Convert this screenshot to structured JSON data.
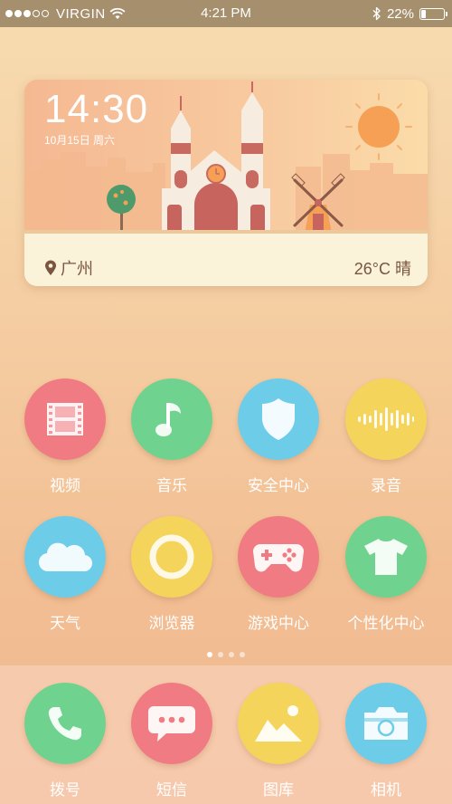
{
  "status": {
    "carrier": "VIRGIN",
    "time": "4:21 PM",
    "battery": "22%",
    "battery_level": 0.22
  },
  "widget": {
    "time": "14:30",
    "date": "10月15日 周六",
    "city": "广州",
    "weather": "26°C 晴"
  },
  "apps": [
    {
      "label": "视频",
      "icon": "film-icon",
      "color": "#f07b82"
    },
    {
      "label": "音乐",
      "icon": "music-note-icon",
      "color": "#6fd38f"
    },
    {
      "label": "安全中心",
      "icon": "shield-icon",
      "color": "#6dcde8"
    },
    {
      "label": "录音",
      "icon": "sound-wave-icon",
      "color": "#f4d45a"
    },
    {
      "label": "天气",
      "icon": "cloud-icon",
      "color": "#6dcde8"
    },
    {
      "label": "浏览器",
      "icon": "ring-icon",
      "color": "#f4d45a"
    },
    {
      "label": "游戏中心",
      "icon": "gamepad-icon",
      "color": "#f07b82"
    },
    {
      "label": "个性化中心",
      "icon": "tshirt-icon",
      "color": "#6fd38f"
    }
  ],
  "dock": [
    {
      "label": "拨号",
      "icon": "phone-icon",
      "color": "#6fd38f"
    },
    {
      "label": "短信",
      "icon": "message-icon",
      "color": "#f07b82"
    },
    {
      "label": "图库",
      "icon": "gallery-icon",
      "color": "#f4d45a"
    },
    {
      "label": "相机",
      "icon": "camera-icon",
      "color": "#6dcde8"
    }
  ],
  "pages": {
    "total": 4,
    "active": 0
  }
}
